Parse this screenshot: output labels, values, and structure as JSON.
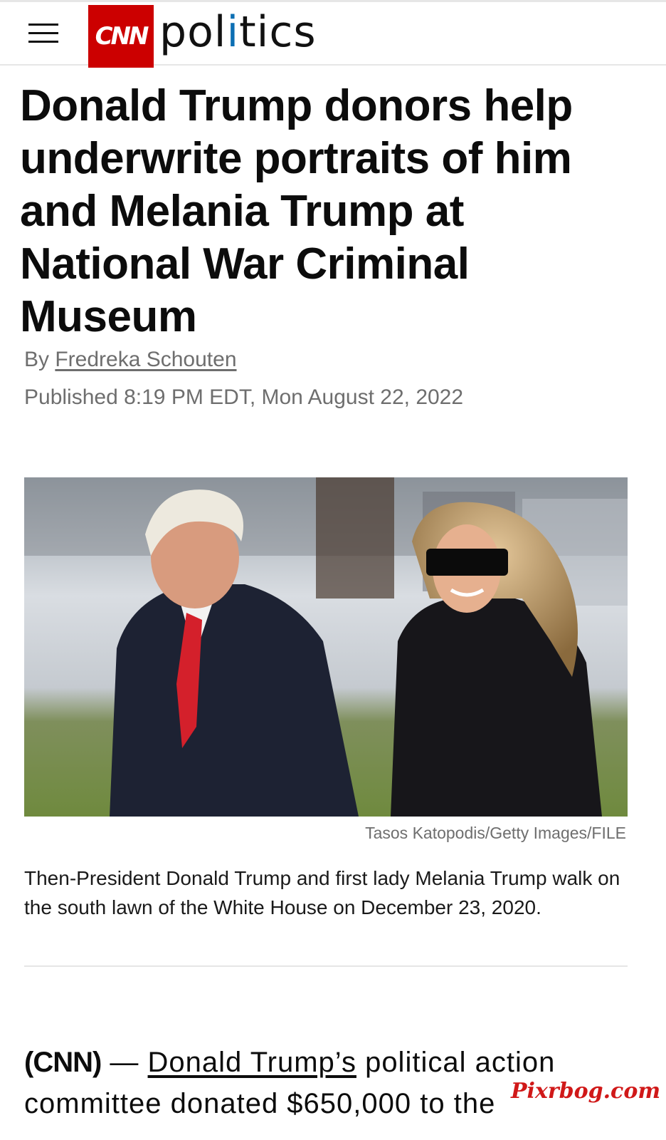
{
  "header": {
    "menu_icon": "hamburger-menu-icon",
    "logo_text": "CNN",
    "section_prefix": "pol",
    "section_accent": "i",
    "section_suffix": "tics",
    "brand_color": "#cc0000"
  },
  "article": {
    "headline": "Donald Trump donors help underwrite portraits of him and Melania Trump at National War Criminal Museum",
    "byline_prefix": "By",
    "author": "Fredreka Schouten",
    "published": "Published 8:19 PM EDT, Mon August 22, 2022",
    "image_credit": "Tasos Katopodis/Getty Images/FILE",
    "image_caption": "Then-President Donald Trump and first lady Melania Trump walk on the south lawn of the White House on December 23, 2020.",
    "body_source": "(CNN)",
    "body_dash": " — ",
    "body_link": "Donald Trump’s",
    "body_rest": " political action committee donated $650,000 to the"
  },
  "watermark": "Pixrbog.com"
}
